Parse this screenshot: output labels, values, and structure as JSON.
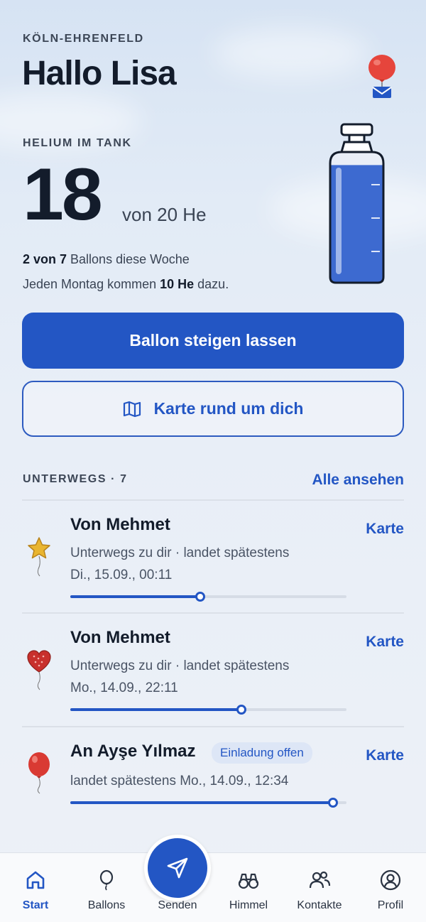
{
  "header": {
    "location": "KÖLN-EHRENFELD",
    "greeting": "Hallo Lisa"
  },
  "helium": {
    "label": "HELIUM IM TANK",
    "value": "18",
    "unit": "von 20 He",
    "fill_fraction": 0.9,
    "weekly_bold": "2 von 7",
    "weekly_rest": " Ballons diese Woche",
    "refill_pre": "Jeden Montag kommen ",
    "refill_bold": "10 He",
    "refill_post": " dazu."
  },
  "actions": {
    "primary_label": "Ballon steigen lassen",
    "secondary_label": "Karte rund um dich"
  },
  "section": {
    "title": "UNTERWEGS · 7",
    "link": "Alle ansehen"
  },
  "items": [
    {
      "icon": "star-balloon-icon",
      "title": "Von Mehmet",
      "line1": "Unterwegs zu dir · landet spätestens",
      "line2": "Di., 15.09., 00:11",
      "link": "Karte",
      "progress": 0.47
    },
    {
      "icon": "heart-balloon-icon",
      "title": "Von Mehmet",
      "line1": "Unterwegs zu dir · landet spätestens",
      "line2": "Mo., 14.09., 22:11",
      "link": "Karte",
      "progress": 0.62
    },
    {
      "icon": "red-balloon-icon",
      "title": "An Ayşe Yılmaz",
      "badge": "Einladung offen",
      "line1": "landet spätestens Mo., 14.09., 12:34",
      "link": "Karte",
      "progress": 0.95
    }
  ],
  "tabs": [
    {
      "label": "Start",
      "icon": "home-icon",
      "active": true
    },
    {
      "label": "Ballons",
      "icon": "balloon-icon"
    },
    {
      "label": "Senden",
      "icon": "send-icon"
    },
    {
      "label": "Himmel",
      "icon": "binoculars-icon"
    },
    {
      "label": "Kontakte",
      "icon": "contacts-icon"
    },
    {
      "label": "Profil",
      "icon": "profile-icon"
    }
  ],
  "colors": {
    "accent": "#2356c4",
    "text": "#131c2b",
    "tank_fill": "#3d6ad0"
  }
}
